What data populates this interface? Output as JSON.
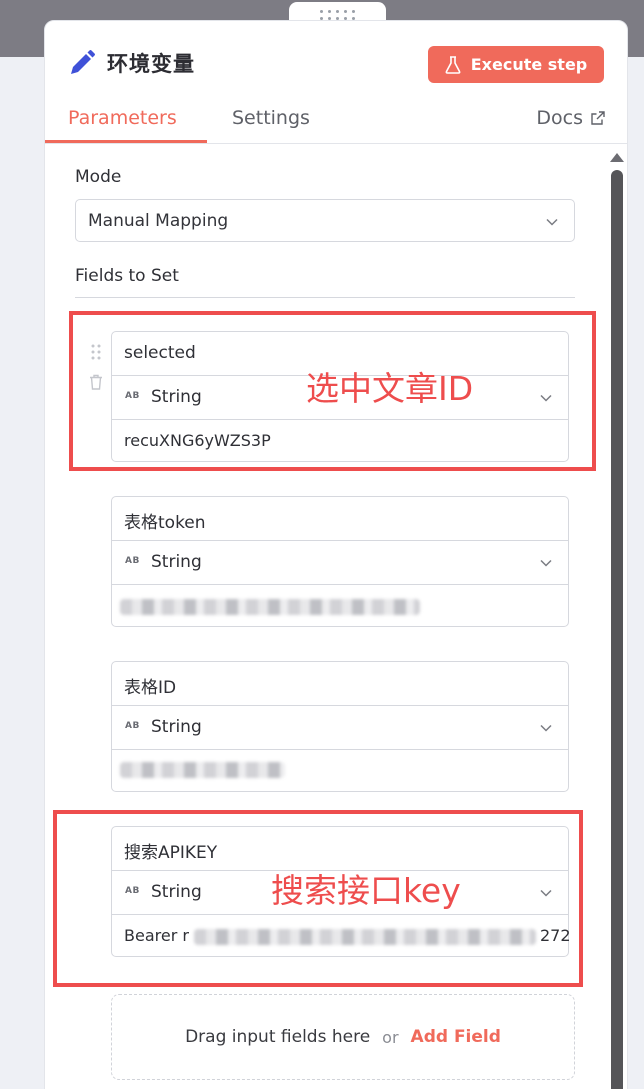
{
  "node": {
    "title": "环境变量",
    "execute_label": "Execute step"
  },
  "tabs": {
    "parameters": "Parameters",
    "settings": "Settings",
    "docs": "Docs"
  },
  "mode": {
    "label": "Mode",
    "value": "Manual Mapping"
  },
  "fields_label": "Fields to Set",
  "fields": [
    {
      "name": "selected",
      "type_badge": "AB",
      "type": "String",
      "value": "recuXNG6yWZS3P"
    },
    {
      "name": "表格token",
      "type_badge": "AB",
      "type": "String",
      "value": ""
    },
    {
      "name": "表格ID",
      "type_badge": "AB",
      "type": "String",
      "value": ""
    },
    {
      "name": "搜索APIKEY",
      "type_badge": "AB",
      "type": "String",
      "value_prefix": "Bearer r",
      "value_suffix": "272"
    }
  ],
  "annotations": {
    "first": "选中文章ID",
    "second": "搜索接口key"
  },
  "dropzone": {
    "text": "Drag input fields here",
    "or": "or",
    "add": "Add Field"
  },
  "colors": {
    "accent": "#f06a5b",
    "annotation": "#ee4d4d",
    "pencil": "#3f51d8"
  }
}
